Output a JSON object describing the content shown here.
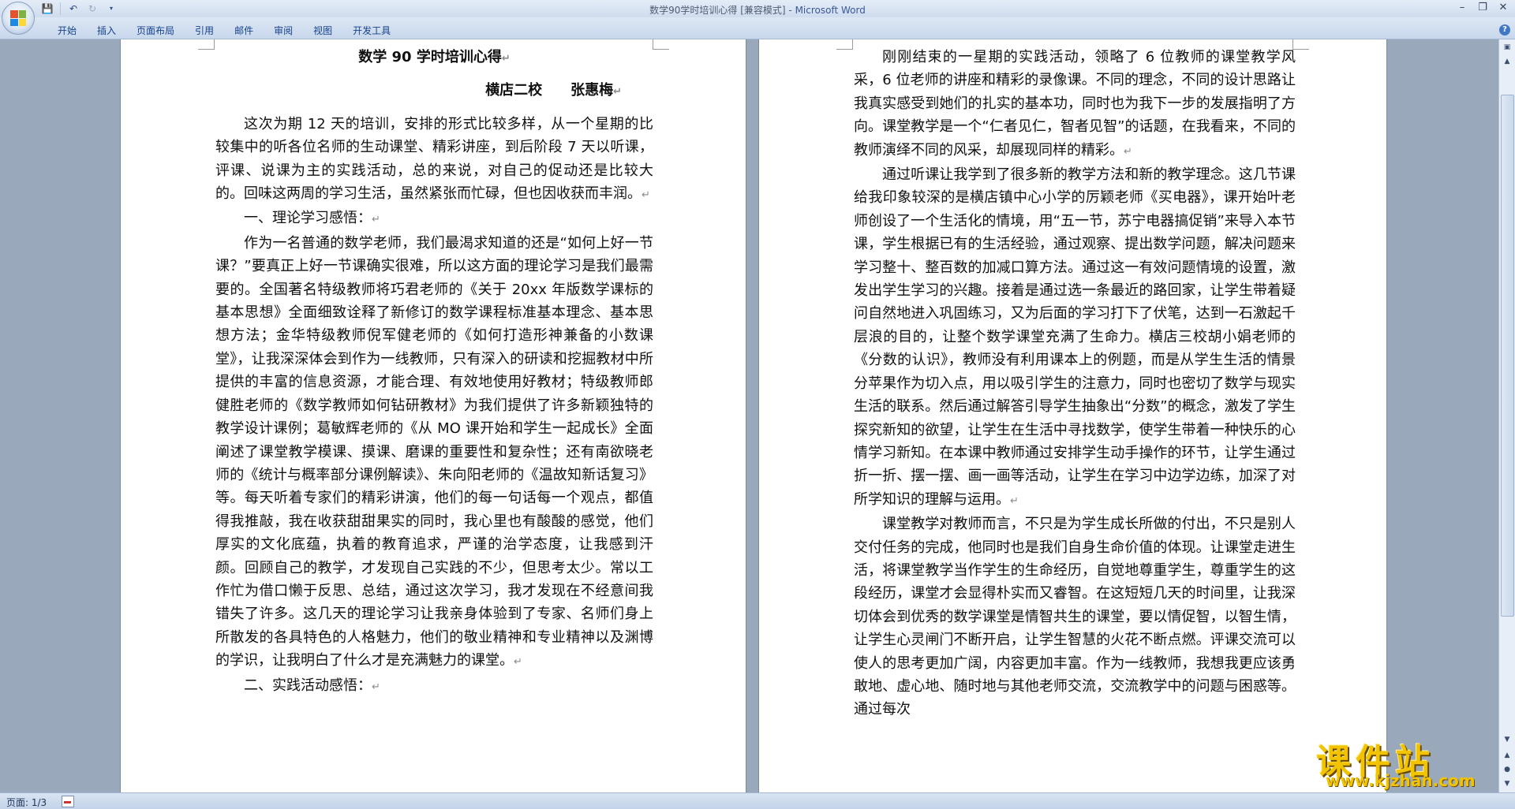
{
  "window": {
    "title": "数学90学时培训心得 [兼容模式] - ",
    "app_name": "Microsoft Word"
  },
  "quick_access": {
    "icons": [
      "save-icon",
      "undo-icon",
      "redo-icon",
      "customize-icon"
    ]
  },
  "ribbon": {
    "tabs": [
      "开始",
      "插入",
      "页面布局",
      "引用",
      "邮件",
      "审阅",
      "视图",
      "开发工具"
    ]
  },
  "document": {
    "title": "数学 90 学时培训心得",
    "author": "横店二校　　张惠梅",
    "page1": [
      "这次为期 12 天的培训，安排的形式比较多样，从一个星期的比较集中的听各位名师的生动课堂、精彩讲座，到后阶段 7 天以听课，评课、说课为主的实践活动，总的来说，对自己的促动还是比较大的。回味这两周的学习生活，虽然紧张而忙碌，但也因收获而丰润。",
      "一、理论学习感悟：",
      "作为一名普通的数学老师，我们最渴求知道的还是“如何上好一节课？”要真正上好一节课确实很难，所以这方面的理论学习是我们最需要的。全国著名特级教师将巧君老师的《关于 20xx 年版数学课标的基本思想》全面细致诠释了新修订的数学课程标准基本理念、基本思想方法；金华特级教师倪军健老师的《如何打造形神兼备的小数课堂》，让我深深体会到作为一线教师，只有深入的研读和挖掘教材中所提供的丰富的信息资源，才能合理、有效地使用好教材；特级教师郎健胜老师的《数学教师如何钻研教材》为我们提供了许多新颖独特的教学设计课例；葛敏辉老师的《从 MO 课开始和学生一起成长》全面阐述了课堂教学模课、摸课、磨课的重要性和复杂性；还有南欲晓老师的《统计与概率部分课例解读》、朱向阳老师的《温故知新话复习》等。每天听着专家们的精彩讲演，他们的每一句话每一个观点，都值得我推敲，我在收获甜甜果实的同时，我心里也有酸酸的感觉，他们厚实的文化底蕴，执着的教育追求，严谨的治学态度，让我感到汗颜。回顾自己的教学，才发现自己实践的不少，但思考太少。常以工作忙为借口懒于反思、总结，通过这次学习，我才发现在不经意间我错失了许多。这几天的理论学习让我亲身体验到了专家、名师们身上所散发的各具特色的人格魅力，他们的敬业精神和专业精神以及渊博的学识，让我明白了什么才是充满魅力的课堂。",
      "二、实践活动感悟："
    ],
    "page2": [
      "刚刚结束的一星期的实践活动，领略了 6 位教师的课堂教学风采，6 位老师的讲座和精彩的录像课。不同的理念，不同的设计思路让我真实感受到她们的扎实的基本功，同时也为我下一步的发展指明了方向。课堂教学是一个“仁者见仁，智者见智”的话题，在我看来，不同的教师演绎不同的风采，却展现同样的精彩。",
      "通过听课让我学到了很多新的教学方法和新的教学理念。这几节课给我印象较深的是横店镇中心小学的厉颖老师《买电器》，课开始叶老师创设了一个生活化的情境，用“五一节，苏宁电器搞促销”来导入本节课，学生根据已有的生活经验，通过观察、提出数学问题，解决问题来学习整十、整百数的加减口算方法。通过这一有效问题情境的设置，激发出学生学习的兴趣。接着是通过选一条最近的路回家，让学生带着疑问自然地进入巩固练习，又为后面的学习打下了伏笔，达到一石激起千层浪的目的，让整个数学课堂充满了生命力。横店三校胡小娟老师的《分数的认识》，教师没有利用课本上的例题，而是从学生生活的情景分苹果作为切入点，用以吸引学生的注意力，同时也密切了数学与现实生活的联系。然后通过解答引导学生抽象出“分数”的概念，激发了学生探究新知的欲望，让学生在生活中寻找数学，使学生带着一种快乐的心情学习新知。在本课中教师通过安排学生动手操作的环节，让学生通过折一折、摆一摆、画一画等活动，让学生在学习中边学边练，加深了对所学知识的理解与运用。",
      "课堂教学对教师而言，不只是为学生成长所做的付出，不只是别人交付任务的完成，他同时也是我们自身生命价值的体现。让课堂走进生活，将课堂教学当作学生的生命经历，自觉地尊重学生，尊重学生的这段经历，课堂才会显得朴实而又睿智。在这短短几天的时间里，让我深切体会到优秀的数学课堂是情智共生的课堂，要以情促智，以智生情，让学生心灵闸门不断开启，让学生智慧的火花不断点燃。评课交流可以使人的思考更加广阔，内容更加丰富。作为一线教师，我想我更应该勇敢地、虚心地、随时地与其他老师交流，交流教学中的问题与困惑等。通过每次"
    ],
    "paragraph_mark": "↵"
  },
  "status_bar": {
    "page_info": "页面: 1/3"
  },
  "watermark": {
    "main": "课件站",
    "url": "www.kjzhan.com"
  },
  "colors": {
    "title_accent": "#3b5998",
    "tab_text": "#15428b",
    "watermark_yellow": "#f2c400",
    "background": "#9aa8bc"
  }
}
